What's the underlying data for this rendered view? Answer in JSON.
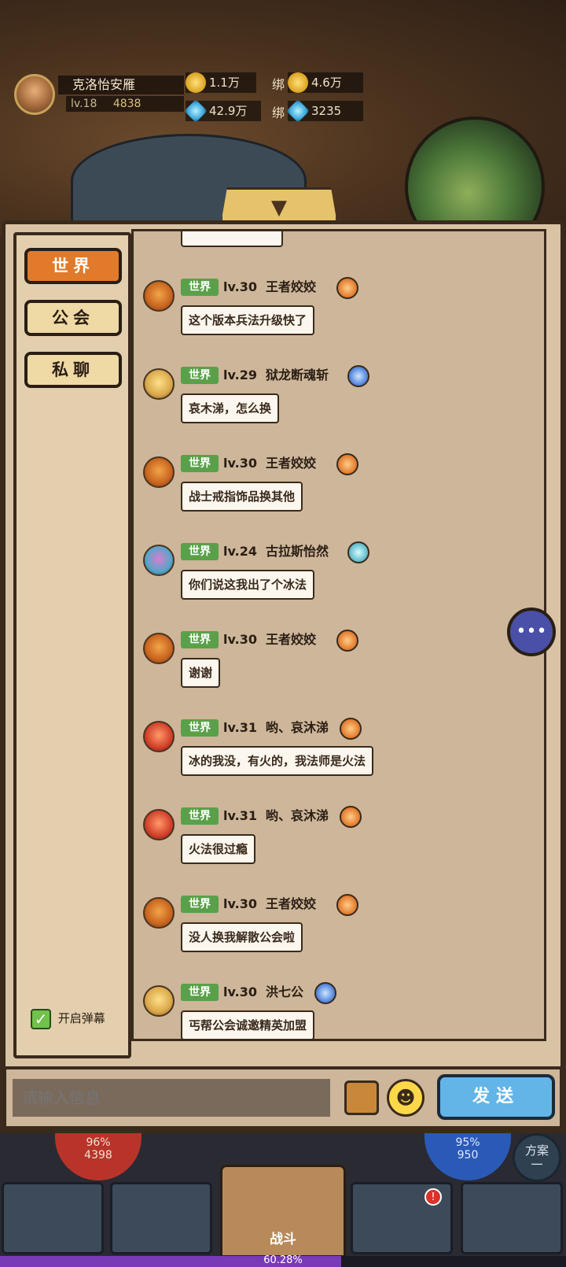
{
  "player": {
    "name": "克洛怡安雁",
    "level": "lv.18",
    "power": "4838"
  },
  "resources": {
    "gold": "1.1万",
    "bound_gold_label": "绑",
    "bound_gold": "4.6万",
    "gems": "42.9万",
    "bound_gems_label": "绑",
    "bound_gems": "3235"
  },
  "tabs": [
    {
      "label": "世界",
      "active": true
    },
    {
      "label": "公会",
      "active": false
    },
    {
      "label": "私聊",
      "active": false
    }
  ],
  "danmu": {
    "label": "开启弹幕",
    "checked": true
  },
  "messages": [
    {
      "channel": "世界",
      "level": "lv.30",
      "name": "王者姣姣",
      "text": "这个版本兵法升级快了",
      "avatar": "orange",
      "badge": "orange"
    },
    {
      "channel": "世界",
      "level": "lv.29",
      "name": "狱龙断魂斩",
      "text": "哀木涕，怎么换",
      "avatar": "yellow",
      "badge": "blue"
    },
    {
      "channel": "世界",
      "level": "lv.30",
      "name": "王者姣姣",
      "text": "战士戒指饰品换其他",
      "avatar": "orange",
      "badge": "orange"
    },
    {
      "channel": "世界",
      "level": "lv.24",
      "name": "古拉斯怡然",
      "text": "你们说这我出了个冰法",
      "avatar": "blue",
      "badge": "teal"
    },
    {
      "channel": "世界",
      "level": "lv.30",
      "name": "王者姣姣",
      "text": "谢谢",
      "avatar": "orange",
      "badge": "orange"
    },
    {
      "channel": "世界",
      "level": "lv.31",
      "name": "哟、哀沐涕",
      "text": "冰的我没，有火的，我法师是火法",
      "avatar": "red",
      "badge": "orange"
    },
    {
      "channel": "世界",
      "level": "lv.31",
      "name": "哟、哀沐涕",
      "text": "火法很过瘾",
      "avatar": "red",
      "badge": "orange"
    },
    {
      "channel": "世界",
      "level": "lv.30",
      "name": "王者姣姣",
      "text": "没人换我解散公会啦",
      "avatar": "orange",
      "badge": "orange"
    },
    {
      "channel": "世界",
      "level": "lv.30",
      "name": "洪七公",
      "text": "丐帮公会诚邀精英加盟",
      "avatar": "yellow",
      "badge": "blue"
    }
  ],
  "input": {
    "placeholder": "请输入信息",
    "value": ""
  },
  "send_label": "发送",
  "bottom": {
    "hp_percent": "96%",
    "hp_value": "4398",
    "mp_percent": "95%",
    "mp_value": "950",
    "plan_label": "方案",
    "plan_number": "一",
    "fight_label": "战斗",
    "notification": "!",
    "xp_text": "60.28%",
    "xp_fraction": 0.6028
  },
  "colors": {
    "active_tab": "#e17a2a",
    "channel_badge": "#5aa04a",
    "send_button": "#63b5e8",
    "panel_bg": "#d9c3a5"
  },
  "icons": {
    "toggle": "chevron-down-icon",
    "float_chat": "chat-bubble-icon",
    "chest": "treasure-chest-icon",
    "emoji": "emoji-face-icon"
  }
}
